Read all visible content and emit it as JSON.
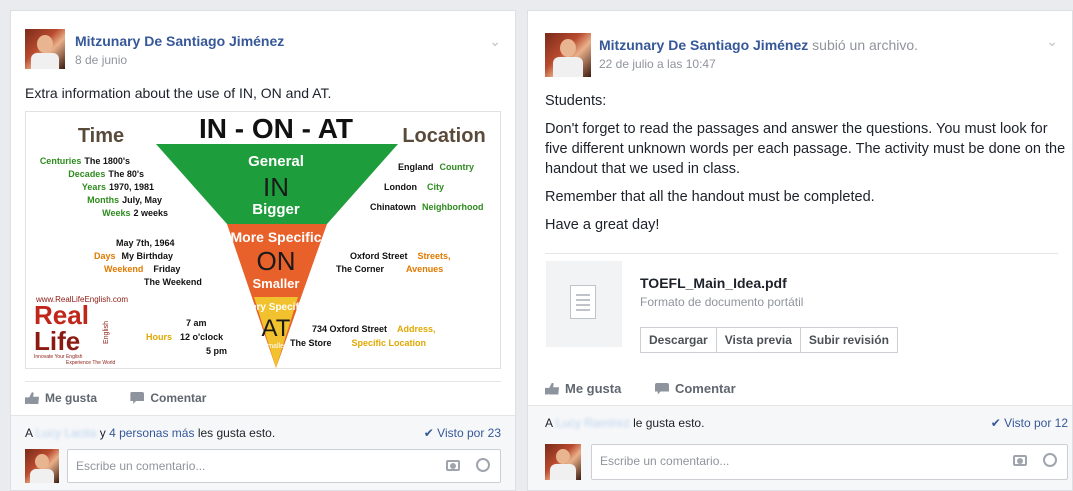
{
  "post1": {
    "author": "Mitzunary De Santiago Jiménez",
    "date": "8 de junio",
    "text": "Extra information about the use of IN, ON and AT.",
    "infographic": {
      "left_heading": "Time",
      "center_heading": "IN - ON - AT",
      "right_heading": "Location",
      "in_label_top": "General",
      "in_label": "IN",
      "in_label_bottom": "Bigger",
      "on_label_top": "More Specific",
      "on_label": "ON",
      "on_label_bottom": "Smaller",
      "at_label_top": "Very Specific",
      "at_label": "AT",
      "at_label_bottom": "Smallest",
      "in_time": [
        {
          "cat": "Centuries",
          "ex": "The 1800's"
        },
        {
          "cat": "Decades",
          "ex": "The 80's"
        },
        {
          "cat": "Years",
          "ex": "1970, 1981"
        },
        {
          "cat": "Months",
          "ex": "July, May"
        },
        {
          "cat": "Weeks",
          "ex": "2 weeks"
        }
      ],
      "in_location": [
        {
          "ex": "England",
          "cat": "Country"
        },
        {
          "ex": "London",
          "cat": "City"
        },
        {
          "ex": "Chinatown",
          "cat": "Neighborhood"
        }
      ],
      "on_time_ex1": "May 7th, 1964",
      "on_time_cat2": "Days",
      "on_time_ex2": "My Birthday",
      "on_time_cat3": "Weekend",
      "on_time_ex3": "Friday",
      "on_time_ex4": "The Weekend",
      "on_loc_ex1": "Oxford Street",
      "on_loc_cat1": "Streets,",
      "on_loc_ex2": "The Corner",
      "on_loc_cat2": "Avenues",
      "at_time_cat": "Hours",
      "at_time_ex1": "7 am",
      "at_time_ex2": "12 o'clock",
      "at_time_ex3": "5 pm",
      "at_loc_ex1": "734 Oxford Street",
      "at_loc_cat1": "Address,",
      "at_loc_ex2": "The Store",
      "at_loc_cat2": "Specific Location",
      "logo_line1": "Real",
      "logo_line2": "Life",
      "logo_side": "English",
      "logo_url": "www.RealLifeEnglish.com",
      "logo_tag1": "Innovate Your English",
      "logo_tag2": "Experience The World"
    },
    "like_label": "Me gusta",
    "comment_label": "Comentar",
    "likes_prefix": "A",
    "likes_blurred": "Lucy Lacita",
    "likes_middle": "y",
    "likes_link": "4 personas más",
    "likes_suffix": "les gusta esto.",
    "seen": "Visto por 23",
    "comment_placeholder": "Escribe un comentario..."
  },
  "post2": {
    "author": "Mitzunary De Santiago Jiménez",
    "action": "subió un archivo.",
    "date": "22 de julio a las 10:47",
    "paragraphs": [
      "Students:",
      "Don't forget to read the passages and answer the questions. You must look for five different unknown words per each passage. The activity must be done on the handout that we used in class.",
      "Remember that all the handout must be completed.",
      "Have a great day!"
    ],
    "file_name": "TOEFL_Main_Idea.pdf",
    "file_type": "Formato de documento portátil",
    "buttons": [
      "Descargar",
      "Vista previa",
      "Subir revisión"
    ],
    "like_label": "Me gusta",
    "comment_label": "Comentar",
    "likes_prefix": "A",
    "likes_blurred": "Lucy Ramírez",
    "likes_suffix": "le gusta esto.",
    "seen": "Visto por 12",
    "comment_placeholder": "Escribe un comentario..."
  },
  "colors": {
    "link": "#365899",
    "in_green": "#1e9d3c",
    "on_orange": "#e8612a",
    "at_yellow": "#f2c22e",
    "dark_red": "#8b1a12",
    "orange_text": "#e07a00",
    "green_text": "#2e8b1e"
  }
}
